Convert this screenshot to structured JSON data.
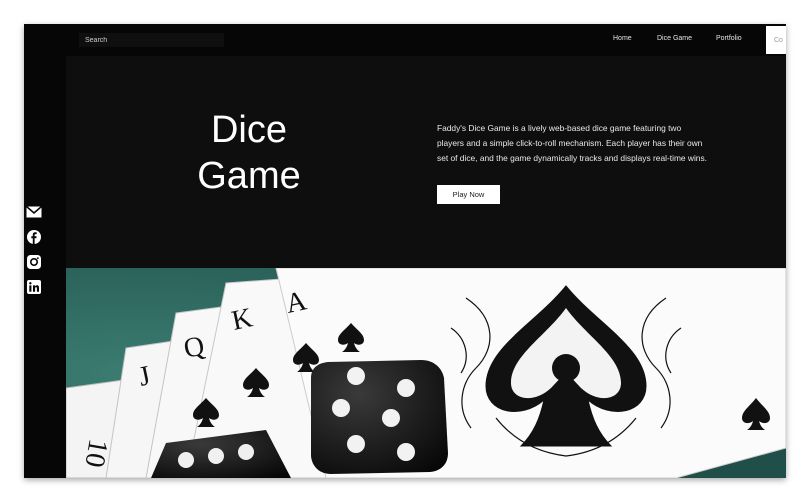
{
  "search": {
    "placeholder": "Search"
  },
  "nav": {
    "items": [
      "Home",
      "Dice Game",
      "Portfolio"
    ],
    "contact_label": "Co"
  },
  "hero": {
    "title_line1": "Dice",
    "title_line2": "Game",
    "description": "Faddy's Dice Game is a lively web-based dice game featuring two players and a simple click-to-roll mechanism. Each player has their own set of dice, and the game dynamically tracks and displays real-time wins.",
    "cta_label": "Play Now"
  },
  "social": [
    "mail-icon",
    "facebook-icon",
    "instagram-icon",
    "linkedin-icon"
  ],
  "image": {
    "subject": "playing-cards-and-dice-icon",
    "card_ranks": [
      "10",
      "J",
      "Q",
      "K",
      "A"
    ]
  },
  "colors": {
    "background": "#0e0e0e",
    "sidebar": "#060606",
    "text": "#ffffff",
    "table_green": "#2f6b62"
  }
}
